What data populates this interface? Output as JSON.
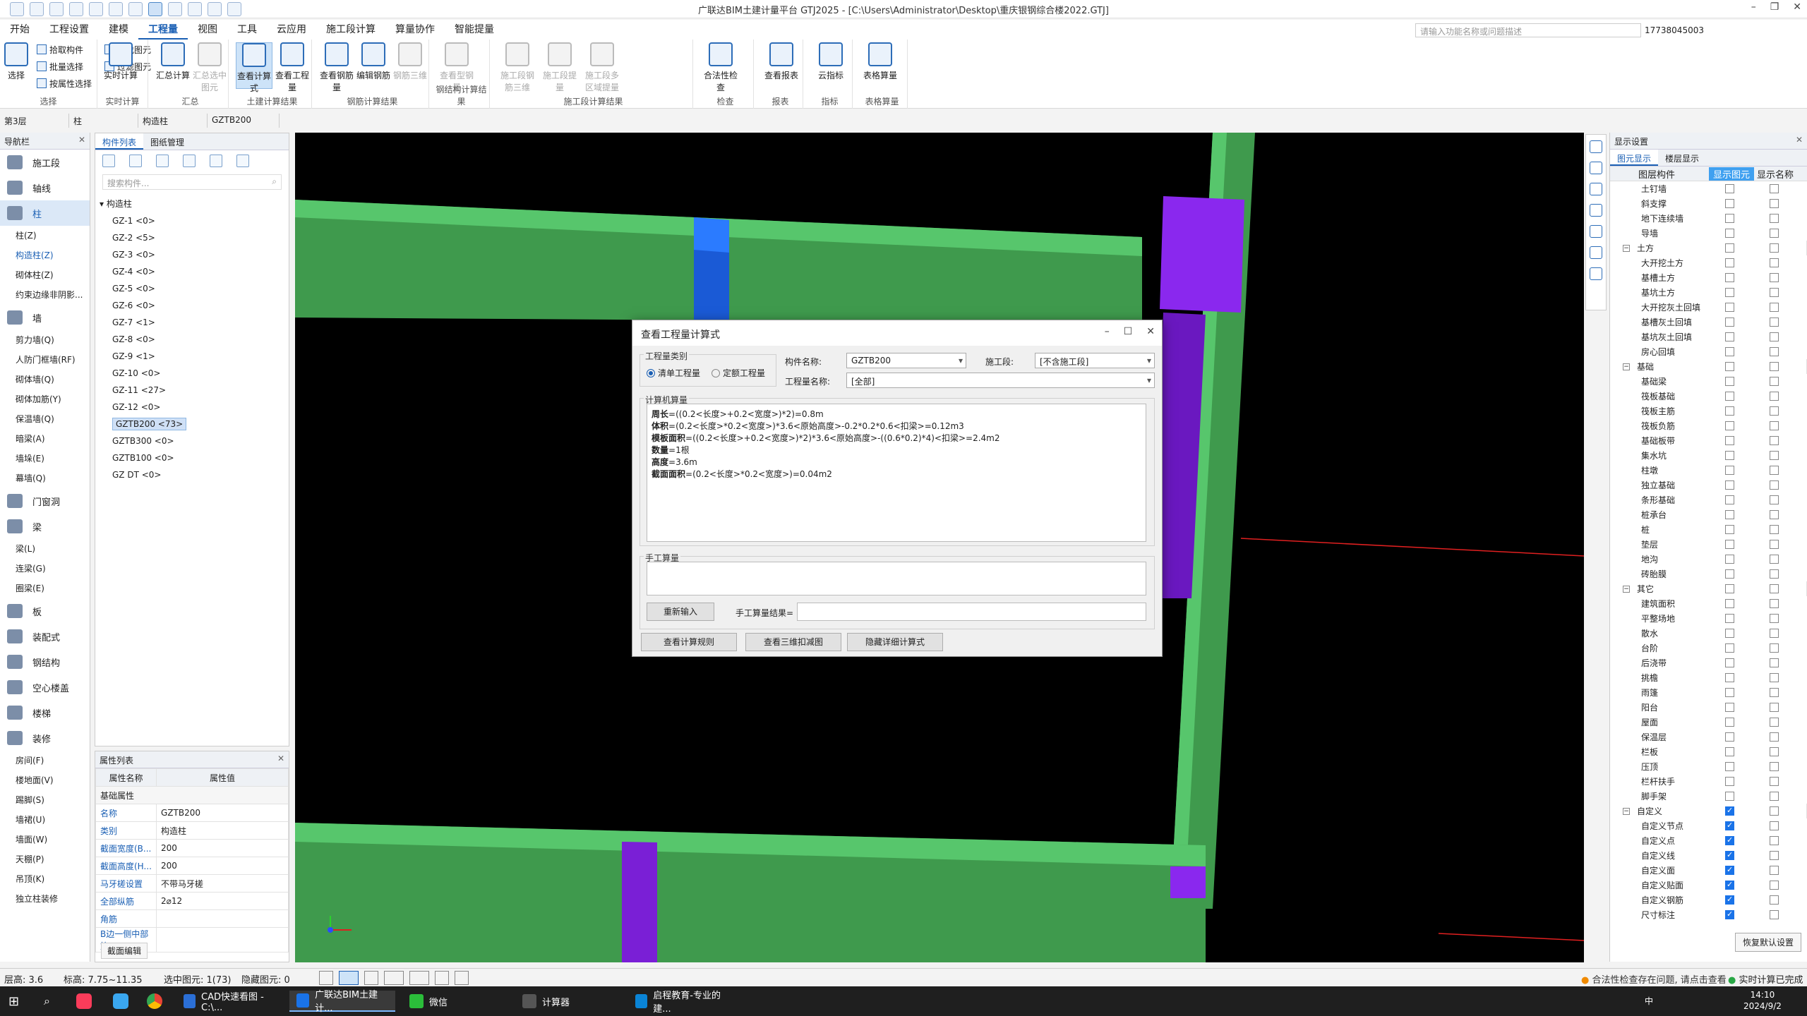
{
  "window": {
    "title": "广联达BIM土建计量平台 GTJ2025 - [C:\\Users\\Administrator\\Desktop\\重庆银钢综合楼2022.GTJ]"
  },
  "menu": {
    "items": [
      "开始",
      "工程设置",
      "建模",
      "工程量",
      "视图",
      "工具",
      "云应用",
      "施工段计算",
      "算量协作",
      "智能提量"
    ],
    "active_index": 3,
    "search_placeholder": "请输入功能名称或问题描述",
    "user_id": "17738045003"
  },
  "ribbon": {
    "groups": [
      {
        "label": "选择",
        "big": [
          {
            "label": "选择"
          }
        ],
        "small": [
          "拾取构件",
          "批量选择",
          "按属性选择",
          "查找图元",
          "过滤图元"
        ]
      },
      {
        "label": "实时计算",
        "big": [
          {
            "label": "实时计算"
          }
        ]
      },
      {
        "label": "汇总",
        "big": [
          {
            "label": "汇总计算"
          },
          {
            "label": "汇总选中图元",
            "disabled": true
          }
        ]
      },
      {
        "label": "土建计算结果",
        "big": [
          {
            "label": "查看计算式",
            "selected": true
          },
          {
            "label": "查看工程量"
          }
        ]
      },
      {
        "label": "钢筋计算结果",
        "big": [
          {
            "label": "查看钢筋量"
          },
          {
            "label": "编辑钢筋"
          },
          {
            "label": "钢筋三维",
            "disabled": true
          }
        ]
      },
      {
        "label": "钢结构计算结果",
        "big": [
          {
            "label": "查看型钢量",
            "disabled": true
          }
        ]
      },
      {
        "label": "施工段计算结果",
        "big": [
          {
            "label": "施工段钢筋三维",
            "disabled": true
          },
          {
            "label": "施工段提量",
            "disabled": true
          },
          {
            "label": "施工段多区域提量",
            "disabled": true
          }
        ]
      },
      {
        "label": "检查",
        "big": [
          {
            "label": "合法性检查"
          }
        ]
      },
      {
        "label": "报表",
        "big": [
          {
            "label": "查看报表"
          }
        ]
      },
      {
        "label": "指标",
        "big": [
          {
            "label": "云指标"
          }
        ]
      },
      {
        "label": "表格算量",
        "big": [
          {
            "label": "表格算量"
          }
        ]
      }
    ]
  },
  "selector_bar": {
    "floor": "第3层",
    "type": "柱",
    "subtype": "构造柱",
    "component": "GZTB200"
  },
  "nav": {
    "title": "导航栏",
    "categories": [
      {
        "label": "施工段",
        "subs": []
      },
      {
        "label": "轴线",
        "subs": []
      },
      {
        "label": "柱",
        "selected": true,
        "subs": [
          "柱(Z)",
          "构造柱(Z)",
          "砌体柱(Z)",
          "约束边缘非阴影..."
        ],
        "sub_selected": 1
      },
      {
        "label": "墙",
        "subs": [
          "剪力墙(Q)",
          "人防门框墙(RF)",
          "砌体墙(Q)",
          "砌体加筋(Y)",
          "保温墙(Q)",
          "暗梁(A)",
          "墙垛(E)",
          "幕墙(Q)"
        ]
      },
      {
        "label": "门窗洞",
        "subs": []
      },
      {
        "label": "梁",
        "subs": [
          "梁(L)",
          "连梁(G)",
          "圈梁(E)"
        ]
      },
      {
        "label": "板",
        "subs": []
      },
      {
        "label": "装配式",
        "subs": []
      },
      {
        "label": "钢结构",
        "subs": []
      },
      {
        "label": "空心楼盖",
        "subs": []
      },
      {
        "label": "楼梯",
        "subs": []
      },
      {
        "label": "装修",
        "subs": [
          "房间(F)",
          "楼地面(V)",
          "踢脚(S)",
          "墙裙(U)",
          "墙面(W)",
          "天棚(P)",
          "吊顶(K)",
          "独立柱装修"
        ]
      }
    ]
  },
  "component_list": {
    "tabs": [
      "构件列表",
      "图纸管理"
    ],
    "search_placeholder": "搜索构件...",
    "group": "构造柱",
    "items": [
      "GZ-1 <0>",
      "GZ-2 <5>",
      "GZ-3 <0>",
      "GZ-4 <0>",
      "GZ-5 <0>",
      "GZ-6 <0>",
      "GZ-7 <1>",
      "GZ-8 <0>",
      "GZ-9 <1>",
      "GZ-10 <0>",
      "GZ-11 <27>",
      "GZ-12 <0>",
      "GZTB200 <73>",
      "GZTB300 <0>",
      "GZTB100 <0>",
      "GZ DT <0>"
    ],
    "selected_index": 12
  },
  "properties": {
    "title": "属性列表",
    "headers": [
      "属性名称",
      "属性值"
    ],
    "group": "基础属性",
    "rows": [
      {
        "k": "名称",
        "v": "GZTB200"
      },
      {
        "k": "类别",
        "v": "构造柱"
      },
      {
        "k": "截面宽度(B...",
        "v": "200"
      },
      {
        "k": "截面高度(H...",
        "v": "200"
      },
      {
        "k": "马牙槎设置",
        "v": "不带马牙槎"
      },
      {
        "k": "全部纵筋",
        "v": "2⌀12"
      },
      {
        "k": "角筋",
        "v": ""
      },
      {
        "k": "B边一侧中部筋",
        "v": ""
      }
    ],
    "bottom_tab": "截面编辑"
  },
  "dialog": {
    "title": "查看工程量计算式",
    "qty_type_label": "工程量类别",
    "radio1": "清单工程量",
    "radio2": "定额工程量",
    "comp_name_label": "构件名称:",
    "comp_name_value": "GZTB200",
    "stage_label": "施工段:",
    "stage_value": "[不含施工段]",
    "qty_name_label": "工程量名称:",
    "qty_name_value": "[全部]",
    "computer_label": "计算机算量",
    "lines": [
      {
        "k": "周长",
        "v": "=((0.2<长度>+0.2<宽度>)*2)=0.8m"
      },
      {
        "k": "体积",
        "v": "=(0.2<长度>*0.2<宽度>)*3.6<原始高度>-0.2*0.2*0.6<扣梁>=0.12m3"
      },
      {
        "k": "模板面积",
        "v": "=((0.2<长度>+0.2<宽度>)*2)*3.6<原始高度>-((0.6*0.2)*4)<扣梁>=2.4m2"
      },
      {
        "k": "数量",
        "v": "=1根"
      },
      {
        "k": "高度",
        "v": "=3.6m"
      },
      {
        "k": "截面面积",
        "v": "=(0.2<长度>*0.2<宽度>)=0.04m2"
      }
    ],
    "manual_label": "手工算量",
    "reinput": "重新输入",
    "manual_result_label": "手工算量结果=",
    "btn_rules": "查看计算规则",
    "btn_3d": "查看三维扣减图",
    "btn_hide": "隐藏详细计算式"
  },
  "display": {
    "title": "显示设置",
    "tabs": [
      "图元显示",
      "楼层显示"
    ],
    "headers": [
      "图层构件",
      "显示图元",
      "显示名称"
    ],
    "rows": [
      {
        "n": "土钉墙",
        "a": false,
        "b": false
      },
      {
        "n": "斜支撑",
        "a": false,
        "b": false
      },
      {
        "n": "地下连续墙",
        "a": false,
        "b": false
      },
      {
        "n": "导墙",
        "a": false,
        "b": false
      },
      {
        "n": "土方",
        "group": true,
        "a": false,
        "b": false
      },
      {
        "n": "大开挖土方",
        "a": false,
        "b": false
      },
      {
        "n": "基槽土方",
        "a": false,
        "b": false
      },
      {
        "n": "基坑土方",
        "a": false,
        "b": false
      },
      {
        "n": "大开挖灰土回填",
        "a": false,
        "b": false
      },
      {
        "n": "基槽灰土回填",
        "a": false,
        "b": false
      },
      {
        "n": "基坑灰土回填",
        "a": false,
        "b": false
      },
      {
        "n": "房心回填",
        "a": false,
        "b": false
      },
      {
        "n": "基础",
        "group": true,
        "a": false,
        "b": false
      },
      {
        "n": "基础梁",
        "a": false,
        "b": false
      },
      {
        "n": "筏板基础",
        "a": false,
        "b": false
      },
      {
        "n": "筏板主筋",
        "a": false,
        "b": false
      },
      {
        "n": "筏板负筋",
        "a": false,
        "b": false
      },
      {
        "n": "基础板带",
        "a": false,
        "b": false
      },
      {
        "n": "集水坑",
        "a": false,
        "b": false
      },
      {
        "n": "柱墩",
        "a": false,
        "b": false
      },
      {
        "n": "独立基础",
        "a": false,
        "b": false
      },
      {
        "n": "条形基础",
        "a": false,
        "b": false
      },
      {
        "n": "桩承台",
        "a": false,
        "b": false
      },
      {
        "n": "桩",
        "a": false,
        "b": false
      },
      {
        "n": "垫层",
        "a": false,
        "b": false
      },
      {
        "n": "地沟",
        "a": false,
        "b": false
      },
      {
        "n": "砖胎膜",
        "a": false,
        "b": false
      },
      {
        "n": "其它",
        "group": true,
        "a": false,
        "b": false
      },
      {
        "n": "建筑面积",
        "a": false,
        "b": false
      },
      {
        "n": "平整场地",
        "a": false,
        "b": false
      },
      {
        "n": "散水",
        "a": false,
        "b": false
      },
      {
        "n": "台阶",
        "a": false,
        "b": false
      },
      {
        "n": "后浇带",
        "a": false,
        "b": false
      },
      {
        "n": "挑檐",
        "a": false,
        "b": false
      },
      {
        "n": "雨篷",
        "a": false,
        "b": false
      },
      {
        "n": "阳台",
        "a": false,
        "b": false
      },
      {
        "n": "屋面",
        "a": false,
        "b": false
      },
      {
        "n": "保温层",
        "a": false,
        "b": false
      },
      {
        "n": "栏板",
        "a": false,
        "b": false
      },
      {
        "n": "压顶",
        "a": false,
        "b": false
      },
      {
        "n": "栏杆扶手",
        "a": false,
        "b": false
      },
      {
        "n": "脚手架",
        "a": false,
        "b": false
      },
      {
        "n": "自定义",
        "group": true,
        "a": true,
        "b": false
      },
      {
        "n": "自定义节点",
        "a": true,
        "b": false
      },
      {
        "n": "自定义点",
        "a": true,
        "b": false
      },
      {
        "n": "自定义线",
        "a": true,
        "b": false
      },
      {
        "n": "自定义面",
        "a": true,
        "b": false
      },
      {
        "n": "自定义贴面",
        "a": true,
        "b": false
      },
      {
        "n": "自定义钢筋",
        "a": true,
        "b": false
      },
      {
        "n": "尺寸标注",
        "a": true,
        "b": false
      }
    ],
    "restore": "恢复默认设置"
  },
  "statusbar": {
    "floor_height": "层高: 3.6",
    "elevation": "标高: 7.75~11.35",
    "selected": "选中图元: 1(73)",
    "hidden": "隐藏图元: 0",
    "legality": "合法性检查存在问题, 请点击查看",
    "realtime": "实时计算已完成"
  },
  "taskbar": {
    "apps": [
      "CAD快速看图 - C:\\...",
      "广联达BIM土建计...",
      "微信",
      "计算器",
      "启程教育-专业的建..."
    ],
    "active_index": 1,
    "time": "14:10",
    "date": "2024/9/2",
    "ime": "中"
  },
  "colors": {
    "accent": "#1a5fb4",
    "green_beam": "#52c46a",
    "purple_col": "#7a1fd6",
    "blue_col": "#1560e0"
  }
}
